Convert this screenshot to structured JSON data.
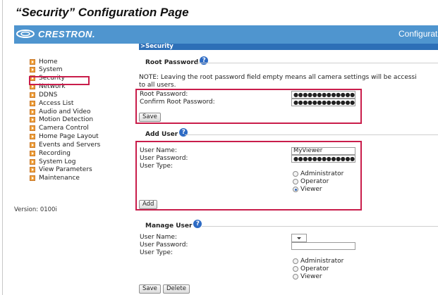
{
  "doc": {
    "title": "“Security” Configuration Page"
  },
  "header": {
    "logo_text": "CRESTRON.",
    "right_text": "Configurati"
  },
  "breadcrumb": ">Security",
  "nav": {
    "items": [
      "Home",
      "System",
      "Security",
      "Network",
      "DDNS",
      "Access List",
      "Audio and Video",
      "Motion Detection",
      "Camera Control",
      "Home Page Layout",
      "Events and Servers",
      "Recording",
      "System Log",
      "View Parameters",
      "Maintenance"
    ],
    "active": "Security"
  },
  "version": "Version: 0100i",
  "root_password": {
    "heading": "Root Password",
    "note_line1": "NOTE: Leaving the root password field empty means all camera settings will be accessi",
    "note_line2": "to all users.",
    "password_label": "Root Password:",
    "confirm_label": "Confirm Root Password:",
    "password_value": "●●●●●●●●●●●●●",
    "confirm_value": "●●●●●●●●●●●●●",
    "save_label": "Save"
  },
  "add_user": {
    "heading": "Add User",
    "username_label": "User Name:",
    "password_label": "User Password:",
    "type_label": "User Type:",
    "username_value": "MyViewer",
    "password_value": "●●●●●●●●●●●●●",
    "types": [
      "Administrator",
      "Operator",
      "Viewer"
    ],
    "selected_type": "Viewer",
    "add_label": "Add"
  },
  "manage_user": {
    "heading": "Manage User",
    "username_label": "User Name:",
    "password_label": "User Password:",
    "type_label": "User Type:",
    "types": [
      "Administrator",
      "Operator",
      "Viewer"
    ],
    "save_label": "Save",
    "delete_label": "Delete"
  },
  "icons": {
    "help": "question-circle-icon",
    "nav_bullet": "orange-arrow-icon",
    "logo": "crestron-swirl-icon"
  },
  "colors": {
    "header_band": "#4f95cf",
    "breadcrumb_bar": "#2d6fb7",
    "highlight": "#c91d4b",
    "nav_bullet": "#f2a23a"
  }
}
